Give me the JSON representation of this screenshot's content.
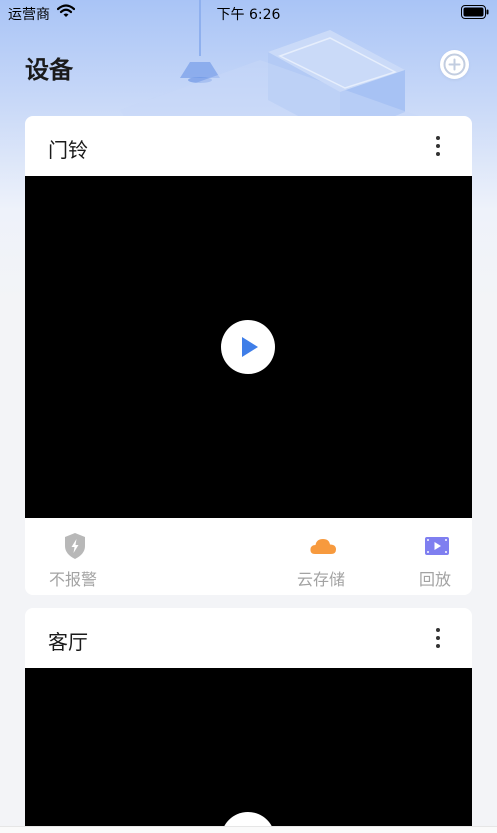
{
  "status_bar": {
    "carrier": "运营商",
    "time": "下午 6:26"
  },
  "header": {
    "title": "设备",
    "add_icon": "plus-circle-icon"
  },
  "devices": [
    {
      "name": "门铃",
      "menu_icon": "more-vertical-icon",
      "video_icon": "play-icon",
      "actions": [
        {
          "icon": "shield-alert-icon",
          "label": "不报警",
          "color": "#b8b8b8"
        },
        {
          "icon": "cloud-icon",
          "label": "云存储",
          "color": "#f79a3e"
        },
        {
          "icon": "video-playback-icon",
          "label": "回放",
          "color": "#7f7ff0"
        }
      ]
    },
    {
      "name": "客厅",
      "menu_icon": "more-vertical-icon",
      "video_icon": "play-icon"
    }
  ],
  "colors": {
    "accent": "#3f7ee8",
    "header_gradient_top": "#a9c4f6",
    "page_background": "#f3f4f7",
    "video_background": "#000000"
  }
}
